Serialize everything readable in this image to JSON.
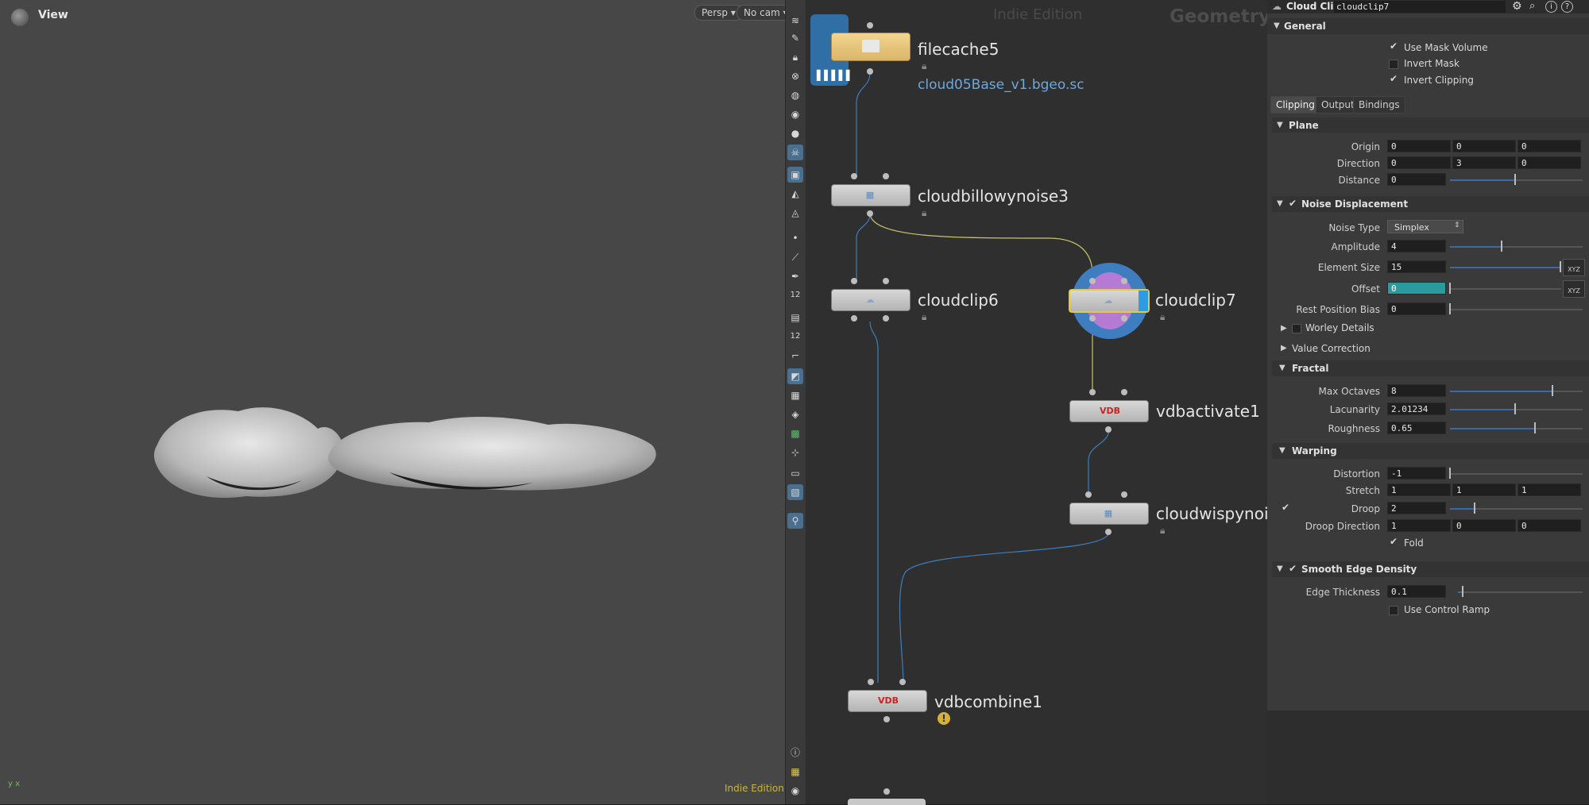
{
  "viewport": {
    "title": "View",
    "camera_mode": "Persp",
    "camera_name": "No cam",
    "edition_badge": "Indie Edition"
  },
  "network": {
    "edition_watermark": "Indie Edition",
    "context_label": "Geometry",
    "nodes": {
      "filecache": {
        "name": "filecache5",
        "file": "cloud05Base_v1.bgeo.sc"
      },
      "billowy": {
        "name": "cloudbillowynoise3"
      },
      "clip6": {
        "name": "cloudclip6"
      },
      "clip7": {
        "name": "cloudclip7"
      },
      "activate": {
        "name": "vdbactivate1",
        "icon": "VDB"
      },
      "wispy": {
        "name": "cloudwispynoi"
      },
      "combine": {
        "name": "vdbcombine1",
        "icon": "VDB"
      }
    }
  },
  "shelf": {
    "badge_12a": "12",
    "badge_12b": "12"
  },
  "params": {
    "node_type": "Cloud Clip",
    "node_name": "cloudclip7",
    "general": {
      "title": "General",
      "use_mask_volume": "Use Mask Volume",
      "invert_mask": "Invert Mask",
      "invert_clipping": "Invert Clipping"
    },
    "tabs": [
      "Clipping",
      "Output",
      "Bindings"
    ],
    "plane": {
      "title": "Plane",
      "origin_label": "Origin",
      "origin": [
        "0",
        "0",
        "0"
      ],
      "direction_label": "Direction",
      "direction": [
        "0",
        "3",
        "0"
      ],
      "distance_label": "Distance",
      "distance": "0"
    },
    "noise": {
      "title": "Noise Displacement",
      "type_label": "Noise Type",
      "type": "Simplex",
      "amplitude_label": "Amplitude",
      "amplitude": "4",
      "element_size_label": "Element Size",
      "element_size": "15",
      "offset_label": "Offset",
      "offset": "0",
      "rest_bias_label": "Rest Position Bias",
      "rest_bias": "0",
      "worley": "Worley Details",
      "value_correction": "Value Correction",
      "xyz": "XYZ"
    },
    "fractal": {
      "title": "Fractal",
      "octaves_label": "Max Octaves",
      "octaves": "8",
      "lacunarity_label": "Lacunarity",
      "lacunarity": "2.01234",
      "roughness_label": "Roughness",
      "roughness": "0.65"
    },
    "warping": {
      "title": "Warping",
      "distortion_label": "Distortion",
      "distortion": "-1",
      "stretch_label": "Stretch",
      "stretch": [
        "1",
        "1",
        "1"
      ],
      "droop_label": "Droop",
      "droop": "2",
      "droop_dir_label": "Droop Direction",
      "droop_dir": [
        "1",
        "0",
        "0"
      ],
      "fold": "Fold"
    },
    "smooth": {
      "title": "Smooth Edge Density",
      "edge_label": "Edge Thickness",
      "edge": "0.1",
      "ramp": "Use Control Ramp"
    }
  }
}
